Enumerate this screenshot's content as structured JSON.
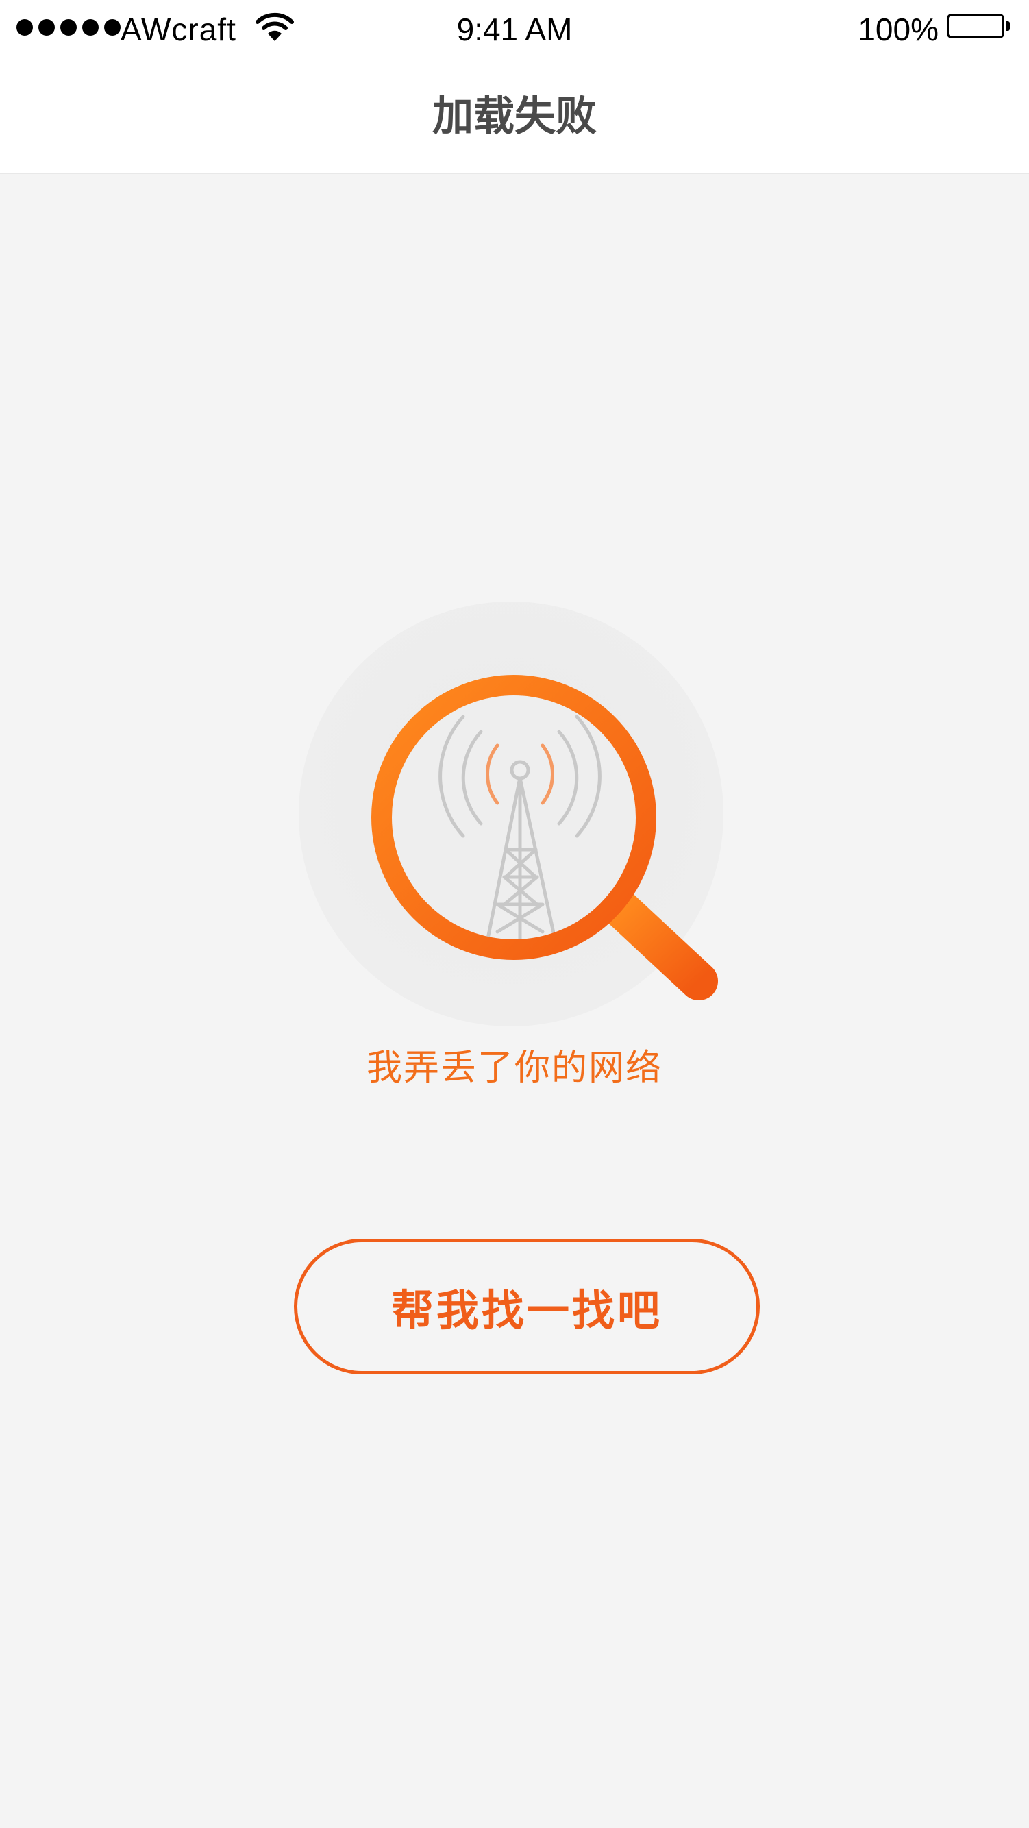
{
  "status_bar": {
    "carrier": "AWcraft",
    "time": "9:41 AM",
    "battery_percent": "100%",
    "signal_bars": 5,
    "battery_level": 1.0
  },
  "nav_bar": {
    "title": "加载失败"
  },
  "empty_state": {
    "illustration": "magnifier-signal-tower",
    "message": "我弄丢了你的网络",
    "action_label": "帮我找一找吧"
  },
  "colors": {
    "accent": "#f05e1a",
    "accent_light": "#ff8a1e",
    "background": "#f4f4f4",
    "nav_background": "#ffffff",
    "title_text": "#4a4a4a",
    "tower_gray": "#c8c8c8"
  }
}
